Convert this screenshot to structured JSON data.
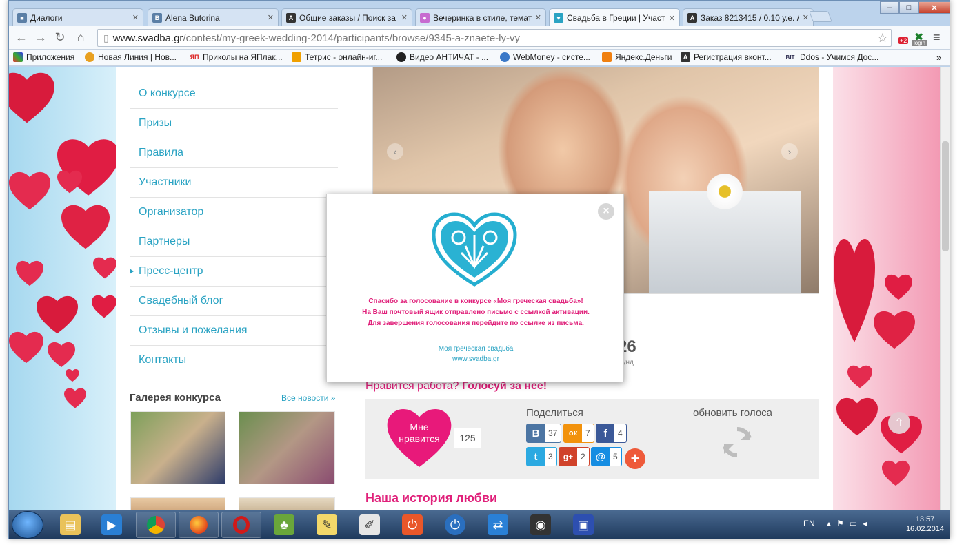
{
  "browser": {
    "tabs": [
      {
        "label": "Диалоги",
        "icon": "vk-icon",
        "color": "#5b7fa6"
      },
      {
        "label": "Alena Butorina",
        "icon": "vk-icon",
        "color": "#5b7fa6"
      },
      {
        "label": "Общие заказы / Поиск за",
        "icon": "a-icon",
        "color": "#333333"
      },
      {
        "label": "Вечеринка в стиле, темат",
        "icon": "balloon-icon",
        "color": "#c76bd0"
      },
      {
        "label": "Свадьба в Греции | Участ",
        "icon": "svadba-icon",
        "color": "#2aa3c3"
      },
      {
        "label": "Заказ 8213415 / 0.10 у.е. /",
        "icon": "a-icon",
        "color": "#333333"
      }
    ],
    "address": {
      "host": "www.svadba.gr",
      "path": "/contest/my-greek-wedding-2014/participants/browse/9345-a-znaete-ly-vy"
    },
    "ext_badge": "+2",
    "ext_login": "login",
    "bookmarks": [
      {
        "label": "Приложения",
        "icon": "apps-icon"
      },
      {
        "label": "Новая Линия | Нов...",
        "icon": "nl-icon"
      },
      {
        "label": "Приколы на ЯПлак...",
        "icon": "yap-icon"
      },
      {
        "label": "Тетрис - онлайн-иг...",
        "icon": "tetris-icon"
      },
      {
        "label": "Видео АНТИЧАТ - ...",
        "icon": "antichat-icon"
      },
      {
        "label": "WebMoney - систе...",
        "icon": "webmoney-icon"
      },
      {
        "label": "Яндекс.Деньги",
        "icon": "yandex-money-icon"
      },
      {
        "label": "Регистрация вконт...",
        "icon": "a-icon"
      },
      {
        "label": "Ddos - Учимся Дос...",
        "icon": "bit-icon"
      }
    ],
    "bookmark_icon_text": {
      "yap": "ЯП",
      "bit": "BIT"
    }
  },
  "menu": [
    {
      "label": "О конкурсе"
    },
    {
      "label": "Призы"
    },
    {
      "label": "Правила"
    },
    {
      "label": "Участники"
    },
    {
      "label": "Организатор"
    },
    {
      "label": "Партнеры"
    },
    {
      "label": "Пресс-центр",
      "active": true
    },
    {
      "label": "Свадебный блог"
    },
    {
      "label": "Отзывы и пожелания"
    },
    {
      "label": "Контакты"
    }
  ],
  "gallery": {
    "title": "Галерея конкурса",
    "more": "Все новости »"
  },
  "votes": {
    "counter": "26",
    "counter_sub": "кунд"
  },
  "like": {
    "prompt": "Нравится работа?",
    "cta": "Голосуй за нее!",
    "button_line1": "Мне",
    "button_line2": "нравится",
    "count": "125"
  },
  "share": {
    "title": "Поделиться",
    "items": [
      {
        "name": "vk",
        "glyph": "B",
        "count": "37",
        "color": "#4c75a3"
      },
      {
        "name": "odnoklassniki",
        "glyph": "ок",
        "count": "7",
        "color": "#f2920c"
      },
      {
        "name": "facebook",
        "glyph": "f",
        "count": "4",
        "color": "#3b5998"
      },
      {
        "name": "twitter",
        "glyph": "t",
        "count": "3",
        "color": "#2ba9e1"
      },
      {
        "name": "google-plus",
        "glyph": "g+",
        "count": "2",
        "color": "#d0422a"
      },
      {
        "name": "mailru",
        "glyph": "@",
        "count": "5",
        "color": "#168de2"
      }
    ],
    "more_glyph": "+"
  },
  "refresh": {
    "title": "обновить голоса"
  },
  "story": {
    "title": "Наша история любви"
  },
  "modal": {
    "message_line1": "Спасибо за голосование в конкурсе «Моя греческая свадьба»!",
    "message_line2": "На Ваш почтовый ящик отправлено письмо с ссылкой активации.",
    "message_line3": "Для завершения голосования перейдите по ссылке из письма.",
    "link_line1": "Моя греческая свадьба",
    "link_line2": "www.svadba.gr",
    "close_glyph": "×"
  },
  "taskbar": {
    "lang": "EN",
    "time": "13:57",
    "date": "16.02.2014"
  },
  "colors": {
    "accent": "#2aa3c3",
    "pink": "#e0207a"
  }
}
